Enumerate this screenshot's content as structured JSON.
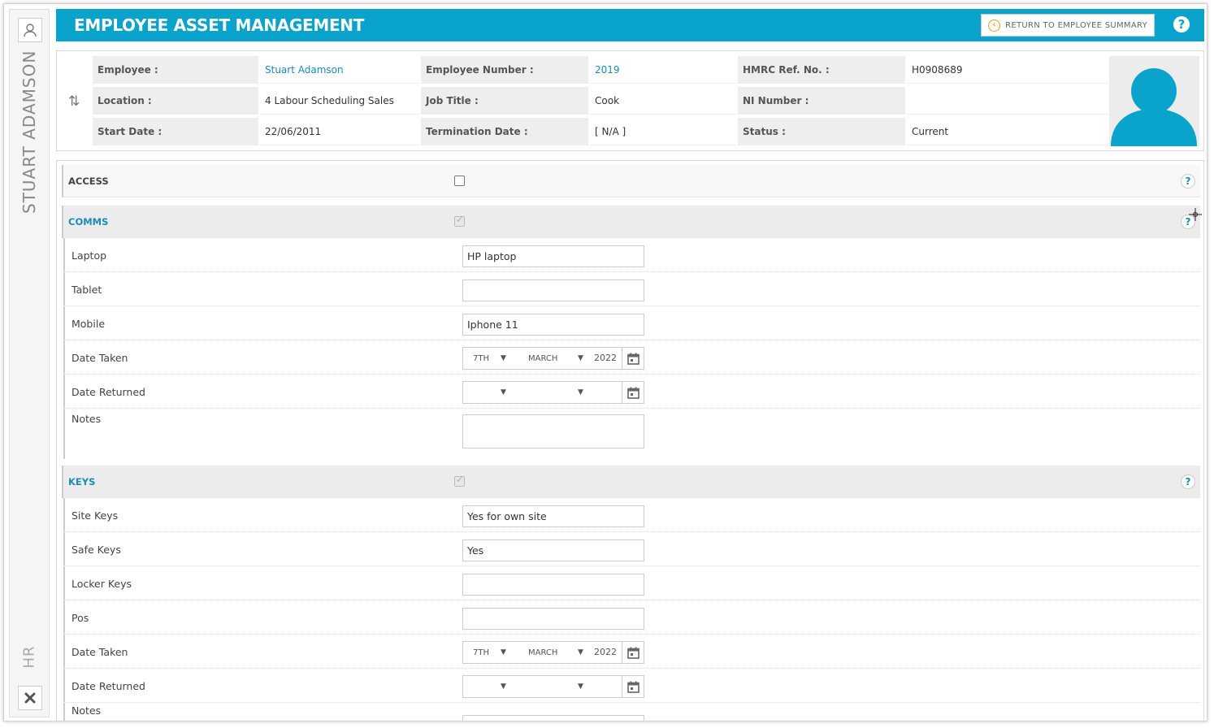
{
  "sidebar": {
    "employee_name_vertical": "STUART ADAMSON",
    "section_vertical": "HR",
    "user_icon": "user-icon",
    "close_icon": "close-icon"
  },
  "header": {
    "title": "EMPLOYEE ASSET MANAGEMENT",
    "return_label": "RETURN TO EMPLOYEE SUMMARY",
    "help": "?"
  },
  "employee": {
    "employee_label": "Employee :",
    "employee_value": "Stuart Adamson",
    "number_label": "Employee Number :",
    "number_value": "2019",
    "hmrc_label": "HMRC Ref. No. :",
    "hmrc_value": "H0908689",
    "location_label": "Location :",
    "location_value": "4 Labour Scheduling Sales",
    "jobtitle_label": "Job Title :",
    "jobtitle_value": "Cook",
    "ni_label": "NI Number :",
    "ni_value": "",
    "start_label": "Start Date :",
    "start_value": "22/06/2011",
    "term_label": "Termination Date :",
    "term_value": "[ N/A ]",
    "status_label": "Status :",
    "status_value": "Current"
  },
  "access": {
    "label": "ACCESS",
    "checked": false
  },
  "comms": {
    "label": "COMMS",
    "checked": true,
    "laptop_label": "Laptop",
    "laptop_value": "HP laptop",
    "tablet_label": "Tablet",
    "tablet_value": "",
    "mobile_label": "Mobile",
    "mobile_value": "Iphone 11",
    "taken_label": "Date Taken",
    "taken_day": "7TH",
    "taken_month": "MARCH",
    "taken_year": "2022",
    "returned_label": "Date Returned",
    "returned_day": "",
    "returned_month": "",
    "returned_year": "",
    "notes_label": "Notes",
    "notes_value": ""
  },
  "keys": {
    "label": "KEYS",
    "checked": true,
    "site_label": "Site Keys",
    "site_value": "Yes for own site",
    "safe_label": "Safe Keys",
    "safe_value": "Yes",
    "locker_label": "Locker Keys",
    "locker_value": "",
    "pos_label": "Pos",
    "pos_value": "",
    "taken_label": "Date Taken",
    "taken_day": "7TH",
    "taken_month": "MARCH",
    "taken_year": "2022",
    "returned_label": "Date Returned",
    "returned_day": "",
    "returned_month": "",
    "returned_year": "",
    "notes_label": "Notes"
  },
  "colors": {
    "brand": "#0aa3cc",
    "link": "#1d8bb8",
    "return_icon": "#f0a020"
  }
}
